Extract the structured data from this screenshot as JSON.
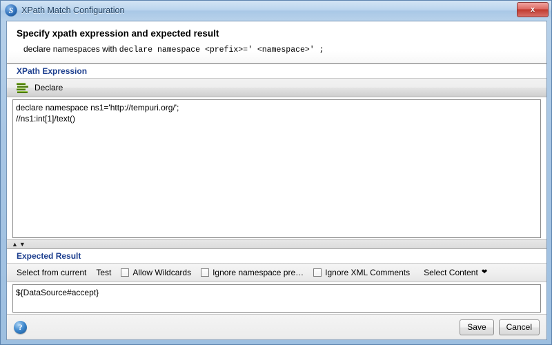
{
  "window": {
    "title": "XPath Match Configuration",
    "app_icon": "soapui-icon",
    "close_label": "x"
  },
  "banner": {
    "title": "Specify xpath expression and expected result",
    "desc_prefix": "declare namespaces with ",
    "desc_code": "declare namespace <prefix>=' <namespace>' ;"
  },
  "xpath_section": {
    "heading": "XPath Expression",
    "declare_icon": "stacked-layers-icon",
    "declare_label": "Declare",
    "editor_value": "declare namespace ns1='http://tempuri.org/';\n//ns1:int[1]/text()"
  },
  "splitter": {
    "collapse_up": "▲",
    "collapse_down": "▼"
  },
  "result_section": {
    "heading": "Expected Result",
    "select_from_current_label": "Select from current",
    "test_label": "Test",
    "checkboxes": [
      {
        "label": "Allow Wildcards",
        "checked": false
      },
      {
        "label": "Ignore namespace pre…",
        "checked": false
      },
      {
        "label": "Ignore XML Comments",
        "checked": false
      }
    ],
    "select_content_label": "Select Content",
    "select_content_caret": "❤",
    "result_value": "${DataSource#accept}"
  },
  "footer": {
    "help_icon": "help-circle-icon",
    "save_label": "Save",
    "cancel_label": "Cancel"
  },
  "colors": {
    "heading_blue": "#1d3f8f",
    "frame_blue": "#9dbfe0",
    "close_red": "#c0392e"
  }
}
